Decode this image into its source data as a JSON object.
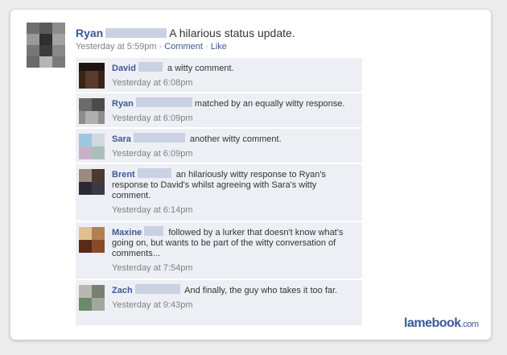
{
  "post": {
    "author": "Ryan",
    "text": "A hilarious status update.",
    "time": "Yesterday at 5:59pm",
    "comment_link": "Comment",
    "like_link": "Like"
  },
  "comments": [
    {
      "author": "David",
      "text": "a witty comment.",
      "time": "Yesterday at 6:08pm"
    },
    {
      "author": "Ryan",
      "text": "matched by an equally witty response.",
      "time": "Yesterday at 6:09pm"
    },
    {
      "author": "Sara",
      "text": "another witty comment.",
      "time": "Yesterday at 6:09pm"
    },
    {
      "author": "Brent",
      "text": "an hilariously witty response to Ryan's response to David's whilst agreeing with Sara's witty comment.",
      "time": "Yesterday at 6:14pm"
    },
    {
      "author": "Maxine",
      "text": "followed by a lurker that doesn't know what's going on, but wants to be part of the witty conversation of comments...",
      "time": "Yesterday at 7:54pm"
    },
    {
      "author": "Zach",
      "text": "And finally, the guy who takes it too far.",
      "time": "Yesterday at 9:43pm"
    }
  ],
  "watermark": {
    "main": "lamebook",
    "suffix": ".com"
  }
}
